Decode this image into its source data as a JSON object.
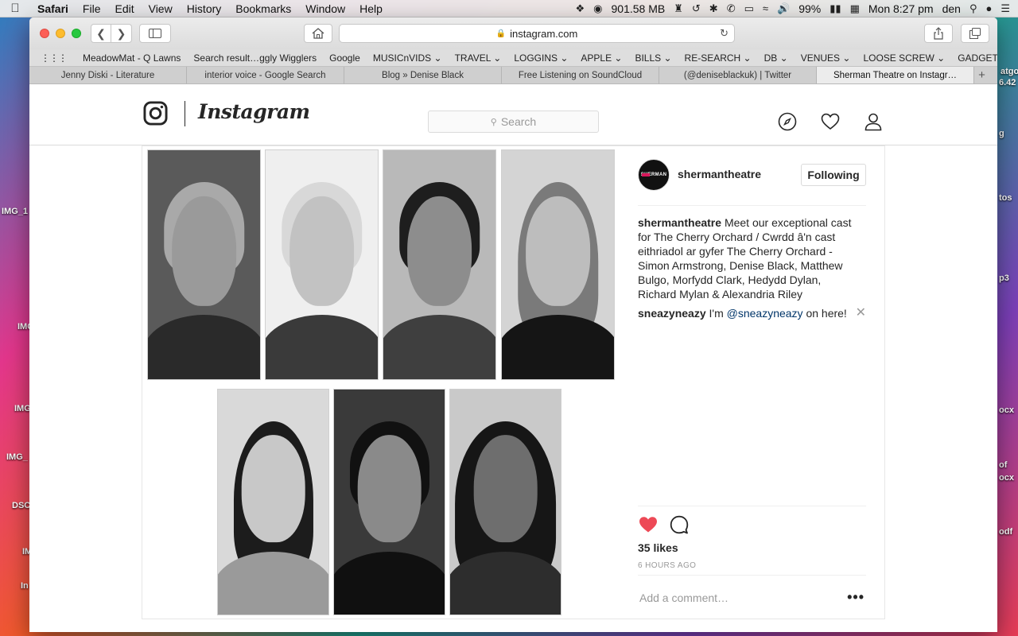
{
  "menubar": {
    "app": "Safari",
    "items": [
      "File",
      "Edit",
      "View",
      "History",
      "Bookmarks",
      "Window",
      "Help"
    ],
    "memory": "901.58 MB",
    "battery": "99%",
    "clock": "Mon 8:27 pm",
    "user": "den"
  },
  "desktop": {
    "labels": [
      "IMG_1",
      "IMG",
      "IMG",
      "IMG_",
      "DSC",
      "IMG",
      "In",
      "atgo",
      "6.42",
      "g",
      "tos",
      "p3",
      "ocx",
      "of",
      "ocx",
      "odf"
    ]
  },
  "browser": {
    "url": "instagram.com",
    "bookmarks": [
      "MeadowMat - Q Lawns",
      "Search result…ggly Wigglers",
      "Google",
      "MUSICnVIDS ⌄",
      "TRAVEL ⌄",
      "LOGGINS ⌄",
      "APPLE ⌄",
      "BILLS ⌄",
      "RE-SEARCH ⌄",
      "DB ⌄",
      "VENUES ⌄",
      "LOOSE SCREW ⌄",
      "GADGETS ⌄"
    ],
    "bookmarks_more": ">>",
    "tabs": [
      "Jenny Diski - Literature",
      "interior voice - Google Search",
      "Blog » Denise Black",
      "Free Listening on SoundCloud",
      "(@deniseblackuk) | Twitter",
      "Sherman Theatre on Instagr…"
    ],
    "new_tab": "+"
  },
  "instagram": {
    "wordmark": "Instagram",
    "search_placeholder": "Search",
    "post": {
      "avatar_text": "SHERMAN",
      "username": "shermantheatre",
      "follow_label": "Following",
      "caption_user": "shermantheatre",
      "caption": "Meet our exceptional cast for The Cherry Orchard / Cwrdd â'n cast eithriadol ar gyfer The Cherry Orchard - Simon Armstrong, Denise Black, Matthew Bulgo, Morfydd Clark, Hedydd Dylan, Richard Mylan & Alexandria Riley",
      "comment_user": "sneazyneazy",
      "comment_pre": "I'm",
      "comment_mention": "@sneazyneazy",
      "comment_post": "on here!",
      "likes": "35 likes",
      "time_ago": "6 HOURS AGO",
      "add_comment": "Add a comment…",
      "more": "•••"
    }
  }
}
